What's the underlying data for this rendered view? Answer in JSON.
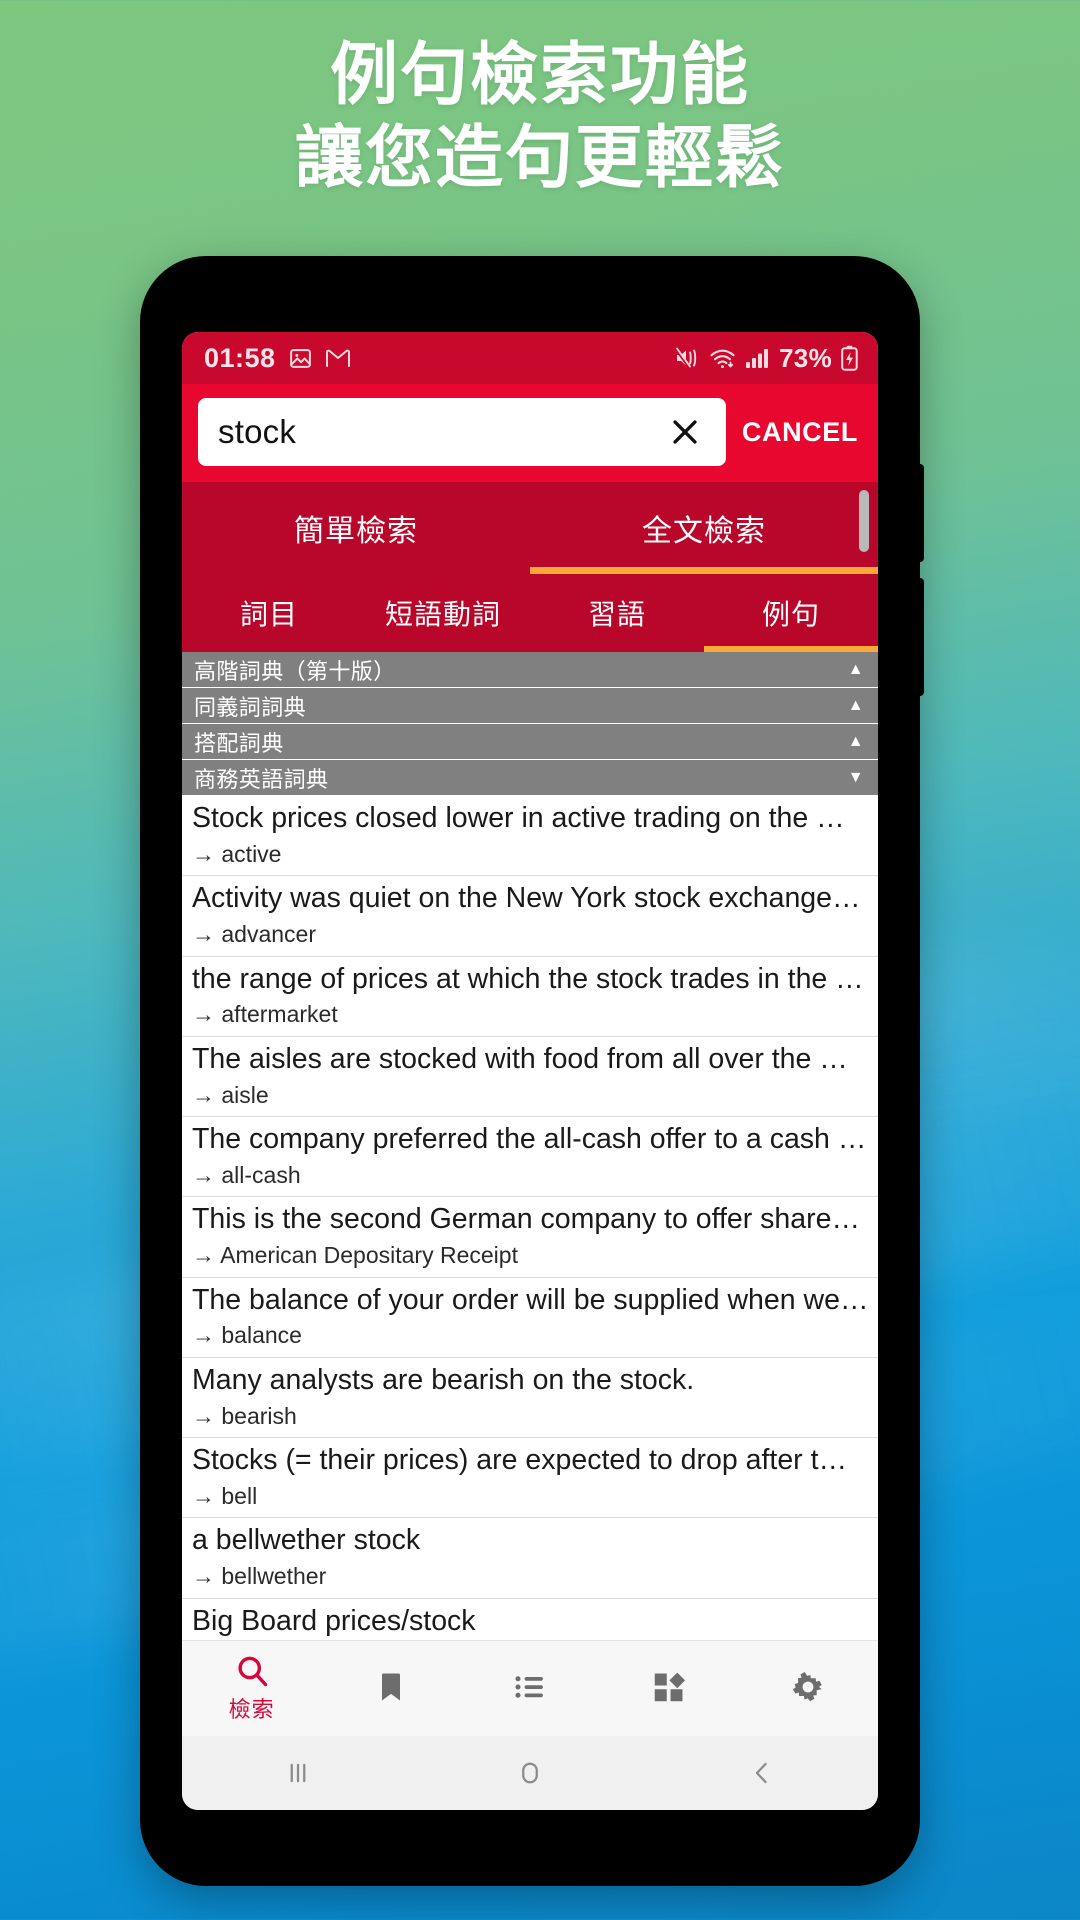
{
  "headline": {
    "line1": "例句檢索功能",
    "line2": "讓您造句更輕鬆"
  },
  "colors": {
    "brand_red": "#e8082f",
    "status_red": "#c9082e",
    "tab_red": "#b8072a",
    "accent_orange": "#f9a938",
    "group_gray": "#808080",
    "active_nav": "#d8073a"
  },
  "statusbar": {
    "time": "01:58",
    "battery_percent": "73%",
    "icons_left": [
      "image-icon",
      "gmail-icon"
    ],
    "icons_right": [
      "mute-vibrate-icon",
      "wifi-icon",
      "signal-icon",
      "battery-charging-icon"
    ]
  },
  "search": {
    "value": "stock",
    "placeholder": "",
    "clear_icon": "close-icon",
    "cancel_label": "CANCEL"
  },
  "tabs_primary": [
    {
      "label": "簡單檢索",
      "active": false
    },
    {
      "label": "全文檢索",
      "active": true
    }
  ],
  "tabs_secondary": [
    {
      "label": "詞目",
      "active": false
    },
    {
      "label": "短語動詞",
      "active": false
    },
    {
      "label": "習語",
      "active": false
    },
    {
      "label": "例句",
      "active": true
    }
  ],
  "dictionary_groups": [
    {
      "label": "高階詞典（第十版）",
      "caret": "▲"
    },
    {
      "label": "同義詞詞典",
      "caret": "▲"
    },
    {
      "label": "搭配詞典",
      "caret": "▲"
    },
    {
      "label": "商務英語詞典",
      "caret": "▼"
    }
  ],
  "results": [
    {
      "sentence": "Stock prices closed lower in active  trading  on the …",
      "headword": "→ active"
    },
    {
      "sentence": "Activity was quiet on the New York stock exchange…",
      "headword": "→ advancer"
    },
    {
      "sentence": "the range of prices at which the stock trades in the …",
      "headword": "→ aftermarket"
    },
    {
      "sentence": "The aisles are stocked with food from all over the …",
      "headword": "→ aisle"
    },
    {
      "sentence": "The company preferred the all-cash offer to a cash …",
      "headword": "→ all-cash"
    },
    {
      "sentence": "This is the second German company to offer share…",
      "headword": "→ American Depositary Receipt"
    },
    {
      "sentence": "The balance of your order will be supplied when we…",
      "headword": "→ balance"
    },
    {
      "sentence": "Many analysts are bearish  on  the stock.",
      "headword": "→ bearish"
    },
    {
      "sentence": "Stocks  (= their prices)  are expected to drop after t…",
      "headword": "→ bell"
    },
    {
      "sentence": "a bellwether stock",
      "headword": "→ bellwether"
    },
    {
      "sentence": "Big Board prices/stock",
      "headword": ""
    }
  ],
  "bottom_nav": [
    {
      "icon": "search-icon",
      "label": "檢索",
      "active": true
    },
    {
      "icon": "bookmark-icon",
      "label": "",
      "active": false
    },
    {
      "icon": "list-icon",
      "label": "",
      "active": false
    },
    {
      "icon": "apps-grid-icon",
      "label": "",
      "active": false
    },
    {
      "icon": "gear-icon",
      "label": "",
      "active": false
    }
  ],
  "android_nav": [
    {
      "icon": "recents-icon"
    },
    {
      "icon": "home-icon"
    },
    {
      "icon": "back-icon"
    }
  ]
}
